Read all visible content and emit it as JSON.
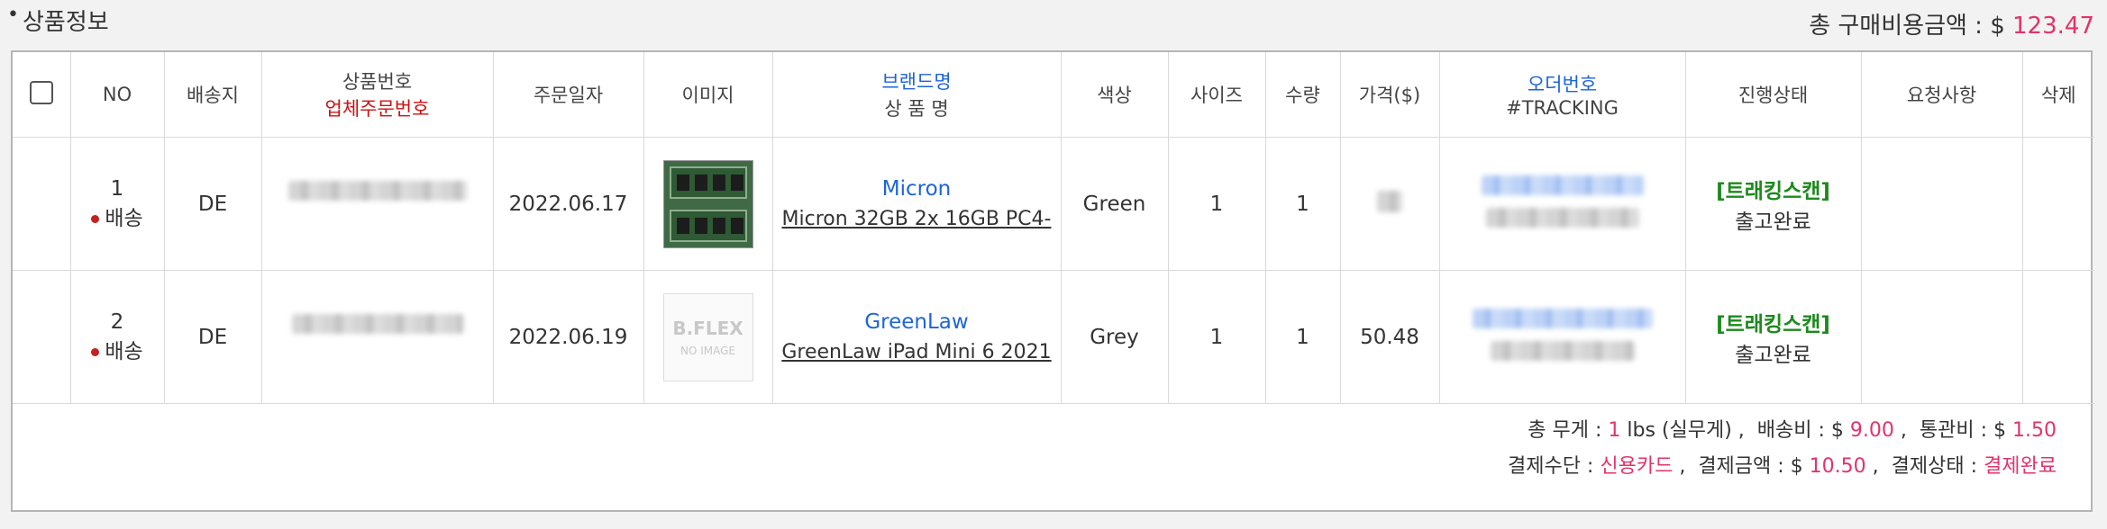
{
  "section": {
    "title": "상품정보",
    "bullet": "•"
  },
  "total": {
    "label": "총 구매비용금액 :",
    "currency": "$",
    "amount": "123.47"
  },
  "table": {
    "headers": {
      "no": "NO",
      "dest": "배송지",
      "product_no": "상품번호",
      "vendor_order_no": "업체주문번호",
      "order_date": "주문일자",
      "image": "이미지",
      "brand": "브랜드명",
      "product_name": "상 품 명",
      "color": "색상",
      "size": "사이즈",
      "qty": "수량",
      "price": "가격($)",
      "order_no": "오더번호",
      "tracking": "#TRACKING",
      "status": "진행상태",
      "request": "요청사항",
      "delete": "삭제"
    },
    "rows": [
      {
        "no": "1",
        "ship_type": "배송",
        "dest": "DE",
        "order_date": "2022.06.17",
        "image": "ram-modules-photo",
        "brand": "Micron",
        "product_name": "Micron 32GB 2x 16GB PC4-",
        "color": "Green",
        "size": "1",
        "qty": "1",
        "price": "",
        "tracking_link": "[트래킹스캔]",
        "status": "출고완료"
      },
      {
        "no": "2",
        "ship_type": "배송",
        "dest": "DE",
        "order_date": "2022.06.19",
        "image": "no-image-placeholder",
        "no_image_brand": "B.FLEX",
        "no_image_text": "NO IMAGE",
        "brand": "GreenLaw",
        "product_name": "GreenLaw iPad Mini 6 2021",
        "color": "Grey",
        "size": "1",
        "qty": "1",
        "price": "50.48",
        "tracking_link": "[트래킹스캔]",
        "status": "출고완료"
      }
    ]
  },
  "summary": {
    "weight_label": "총 무게 :",
    "weight_value": "1",
    "weight_unit": "lbs (실무게) ,",
    "shipping_label": "배송비 : $",
    "shipping_value": "9.00",
    "sep1": ",",
    "customs_label": "통관비 : $",
    "customs_value": "1.50",
    "payment_method_label": "결제수단 :",
    "payment_method_value": "신용카드",
    "sep2": ",",
    "payment_amount_label": "결제금액 : $",
    "payment_amount_value": "10.50",
    "sep3": ",",
    "payment_status_label": "결제상태 :",
    "payment_status_value": "결제완료"
  },
  "colors": {
    "accent_pink": "#e2336b",
    "link_blue": "#1e64d8",
    "status_green": "#1c8a1c",
    "required_red": "#cc1111"
  }
}
